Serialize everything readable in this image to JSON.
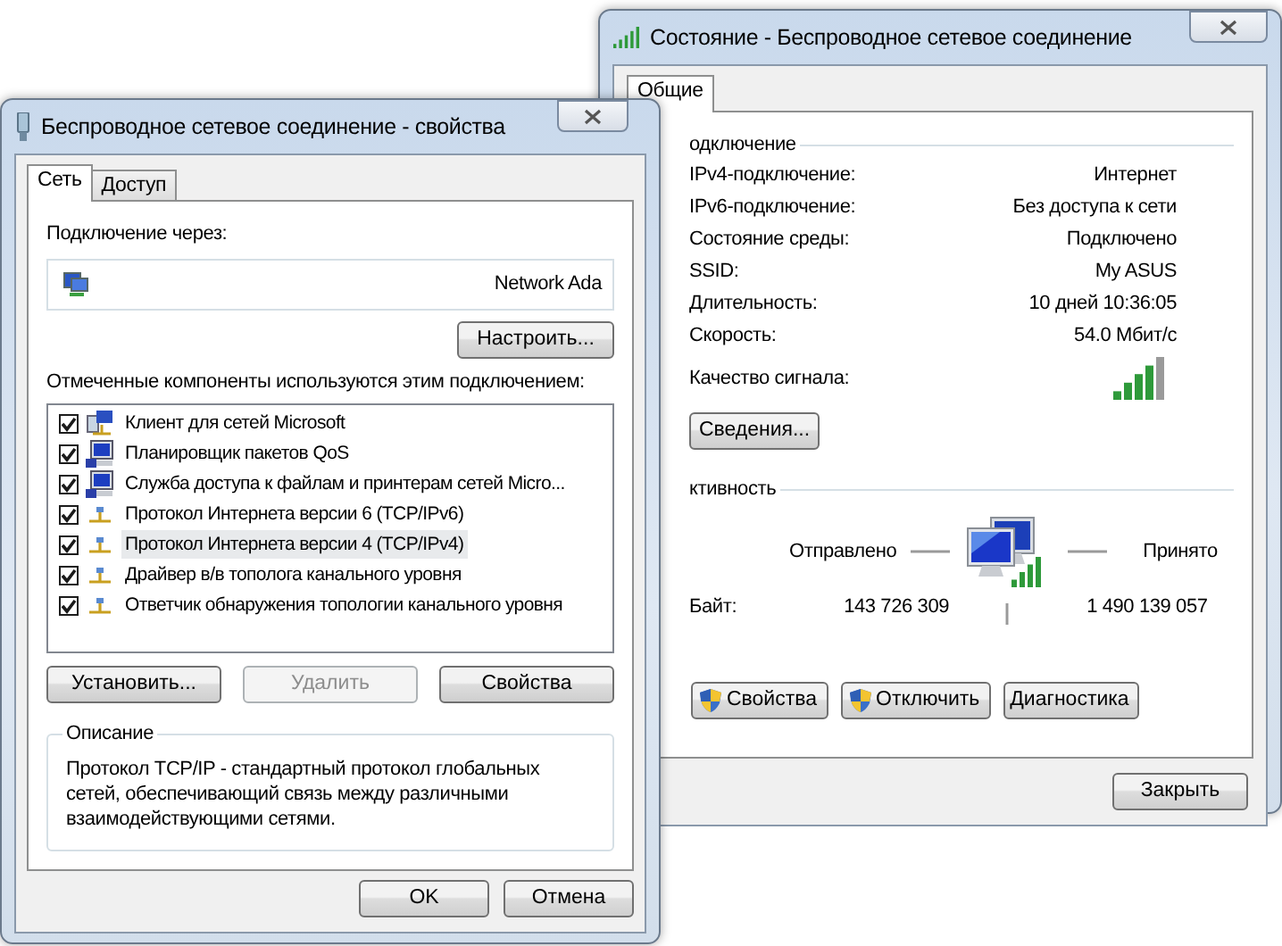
{
  "status_window": {
    "title": "Состояние - Беспроводное сетевое соединение",
    "tabs": [
      {
        "label": "Общие",
        "selected": true
      }
    ],
    "connection_group": {
      "label": "одключение",
      "rows": [
        {
          "label": "IPv4-подключение:",
          "value": "Интернет"
        },
        {
          "label": "IPv6-подключение:",
          "value": "Без доступа к сети"
        },
        {
          "label": "Состояние среды:",
          "value": "Подключено"
        },
        {
          "label": "SSID:",
          "value": "My ASUS"
        },
        {
          "label": "Длительность:",
          "value": "10 дней 10:36:05"
        },
        {
          "label": "Скорость:",
          "value": "54.0 Мбит/с"
        }
      ],
      "signal_label": "Качество сигнала:",
      "details_button": "Сведения..."
    },
    "activity_group": {
      "label": "ктивность",
      "sent_label": "Отправлено",
      "received_label": "Принято",
      "bytes_label": "Байт:",
      "bytes_sent": "143 726 309",
      "bytes_received": "1 490 139 057"
    },
    "buttons": [
      {
        "label": "Свойства",
        "shield": true
      },
      {
        "label": "Отключить",
        "shield": true
      },
      {
        "label": "Диагностика",
        "shield": false
      }
    ],
    "close_button": "Закрыть"
  },
  "properties_window": {
    "title": "Беспроводное сетевое соединение - свойства",
    "tabs": [
      {
        "label": "Сеть",
        "selected": true
      },
      {
        "label": "Доступ",
        "selected": false
      }
    ],
    "connect_using_label": "Подключение через:",
    "adapter": "Network Ada",
    "configure_button": "Настроить...",
    "components_label": "Отмеченные компоненты используются этим подключением:",
    "components": [
      {
        "label": "Клиент для сетей Microsoft",
        "kind": "client",
        "checked": true,
        "selected": false
      },
      {
        "label": "Планировщик пакетов QoS",
        "kind": "service",
        "checked": true,
        "selected": false
      },
      {
        "label": "Служба доступа к файлам и принтерам сетей Micro...",
        "kind": "service",
        "checked": true,
        "selected": false
      },
      {
        "label": "Протокол Интернета версии 6 (TCP/IPv6)",
        "kind": "protocol",
        "checked": true,
        "selected": false
      },
      {
        "label": "Протокол Интернета версии 4 (TCP/IPv4)",
        "kind": "protocol",
        "checked": true,
        "selected": true
      },
      {
        "label": "Драйвер в/в тополога канального уровня",
        "kind": "protocol",
        "checked": true,
        "selected": false
      },
      {
        "label": "Ответчик обнаружения топологии канального уровня",
        "kind": "protocol",
        "checked": true,
        "selected": false
      }
    ],
    "component_buttons": [
      {
        "label": "Установить...",
        "disabled": false
      },
      {
        "label": "Удалить",
        "disabled": true
      },
      {
        "label": "Свойства",
        "disabled": false
      }
    ],
    "description_group": {
      "label": "Описание",
      "text": "Протокол TCP/IP - стандартный протокол глобальных сетей, обеспечивающий связь между различными взаимодействующими сетями."
    },
    "buttons": [
      "OK",
      "Отмена"
    ]
  }
}
